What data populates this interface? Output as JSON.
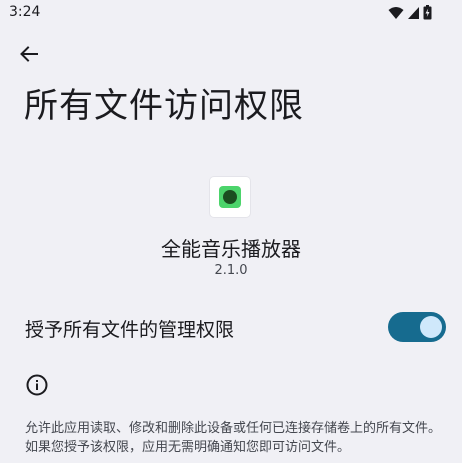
{
  "status_bar": {
    "time": "3:24",
    "icons": [
      "wifi-icon",
      "signal-icon",
      "battery-icon"
    ]
  },
  "header": {
    "back_icon": "arrow-back-icon",
    "title": "所有文件访问权限"
  },
  "app": {
    "name": "全能音乐播放器",
    "version": "2.1.0",
    "icon": "app-icon"
  },
  "permission": {
    "label": "授予所有文件的管理权限",
    "enabled": true
  },
  "info": {
    "icon": "info-icon",
    "description": "允许此应用读取、修改和删除此设备或任何已连接存储卷上的所有文件。如果您授予该权限，应用无需明确通知您即可访问文件。"
  },
  "colors": {
    "background": "#f0f0f5",
    "toggle_track": "#166b8f",
    "toggle_thumb": "#cfe8fb",
    "app_icon_green": "#4cd46b"
  }
}
